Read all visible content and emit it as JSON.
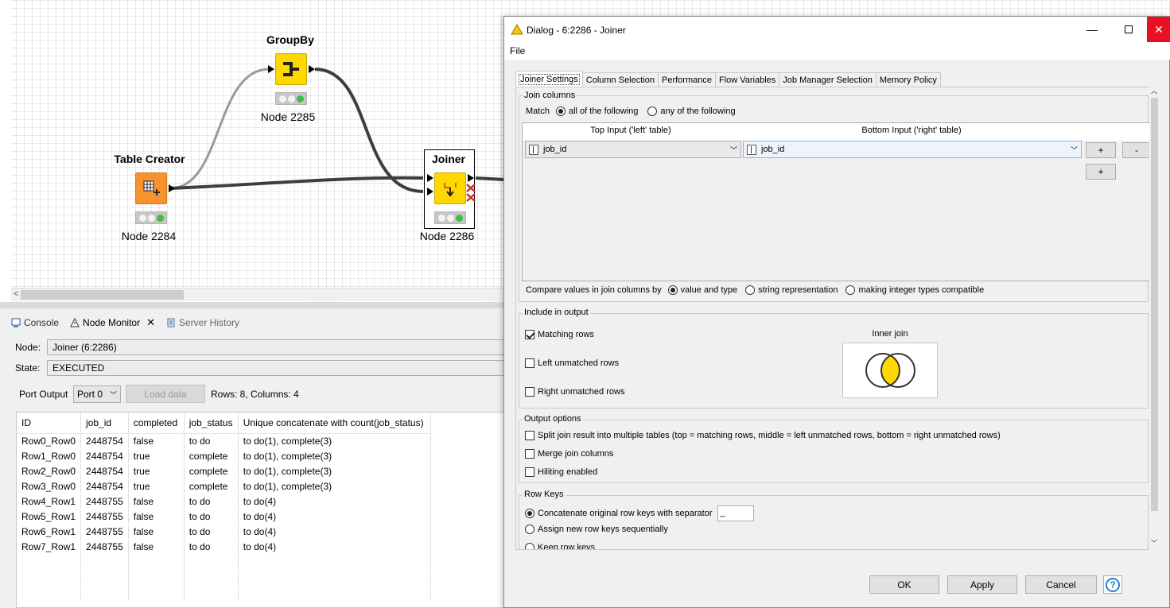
{
  "workflow": {
    "nodes": [
      {
        "title": "GroupBy",
        "label": "Node 2285"
      },
      {
        "title": "Table Creator",
        "label": "Node 2284"
      },
      {
        "title": "Joiner",
        "label": "Node 2286"
      }
    ]
  },
  "bottom_panel": {
    "tabs": [
      {
        "label": "Console",
        "icon": "console-icon"
      },
      {
        "label": "Node Monitor",
        "icon": "warning-triangle-icon"
      },
      {
        "label": "Server History",
        "icon": "server-history-icon"
      }
    ],
    "node_label": "Node:",
    "node_value": "Joiner  (6:2286)",
    "state_label": "State:",
    "state_value": "EXECUTED",
    "port_output_label": "Port Output",
    "port_select": "Port 0",
    "load_data": "Load data",
    "rows_columns": "Rows: 8, Columns: 4",
    "table": {
      "headers": [
        "ID",
        "job_id",
        "completed",
        "job_status",
        "Unique concatenate with count(job_status)"
      ],
      "rows": [
        [
          "Row0_Row0",
          "2448754",
          "false",
          "to do",
          "to do(1), complete(3)"
        ],
        [
          "Row1_Row0",
          "2448754",
          "true",
          "complete",
          "to do(1), complete(3)"
        ],
        [
          "Row2_Row0",
          "2448754",
          "true",
          "complete",
          "to do(1), complete(3)"
        ],
        [
          "Row3_Row0",
          "2448754",
          "true",
          "complete",
          "to do(1), complete(3)"
        ],
        [
          "Row4_Row1",
          "2448755",
          "false",
          "to do",
          "to do(4)"
        ],
        [
          "Row5_Row1",
          "2448755",
          "false",
          "to do",
          "to do(4)"
        ],
        [
          "Row6_Row1",
          "2448755",
          "false",
          "to do",
          "to do(4)"
        ],
        [
          "Row7_Row1",
          "2448755",
          "false",
          "to do",
          "to do(4)"
        ]
      ]
    }
  },
  "dialog": {
    "title": "Dialog - 6:2286 - Joiner",
    "menu": "File",
    "tabs": [
      "Joiner Settings",
      "Column Selection",
      "Performance",
      "Flow Variables",
      "Job Manager Selection",
      "Memory Policy"
    ],
    "join_columns": {
      "title": "Join columns",
      "match_label": "Match",
      "match_all": "all of the following",
      "match_any": "any of the following",
      "top_header": "Top Input ('left' table)",
      "bottom_header": "Bottom Input ('right' table)",
      "left_value": "job_id",
      "right_value": "job_id",
      "plus": "+",
      "minus": "-",
      "compare_label": "Compare values in join columns by",
      "compare_opts": [
        "value and type",
        "string representation",
        "making integer types compatible"
      ]
    },
    "include": {
      "title": "Include in output",
      "matching": "Matching rows",
      "left_unmatched": "Left unmatched rows",
      "right_unmatched": "Right unmatched rows",
      "join_type": "Inner join"
    },
    "output_options": {
      "title": "Output options",
      "split": "Split join result into multiple tables (top = matching rows, middle = left unmatched rows, bottom = right unmatched rows)",
      "merge": "Merge join columns",
      "hiliting": "Hiliting enabled"
    },
    "row_keys": {
      "title": "Row Keys",
      "concat": "Concatenate original row keys with separator",
      "separator": "_",
      "sequential": "Assign new row keys sequentially",
      "keep": "Keep row keys"
    },
    "buttons": {
      "ok": "OK",
      "apply": "Apply",
      "cancel": "Cancel",
      "help": "?"
    }
  },
  "colors": {
    "node_yellow": "#ffd800",
    "node_orange": "#f7932f",
    "venn_fill": "#ffd800",
    "close_red": "#e81123"
  }
}
